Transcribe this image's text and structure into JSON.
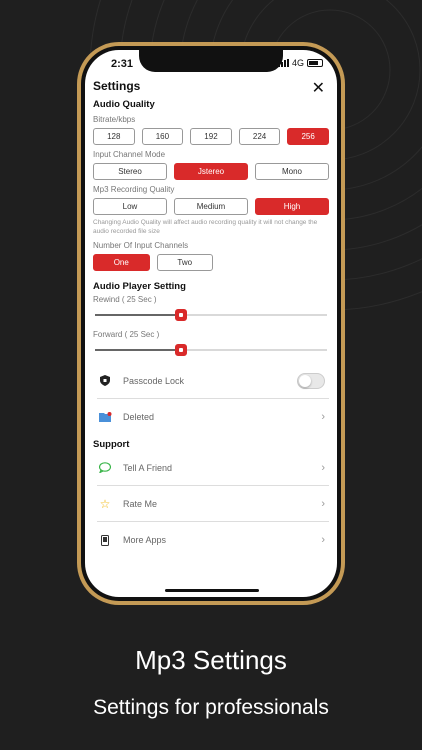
{
  "status": {
    "time": "2:31",
    "network": "4G"
  },
  "header": {
    "title": "Settings",
    "close_icon": "close-icon"
  },
  "audio_quality": {
    "title": "Audio Quality",
    "bitrate_label": "Bitrate/kbps",
    "bitrates": [
      "128",
      "160",
      "192",
      "224",
      "256"
    ],
    "selected_bitrate": "256",
    "channel_mode_label": "Input Channel Mode",
    "channel_modes": [
      "Stereo",
      "Jstereo",
      "Mono"
    ],
    "selected_channel_mode": "Jstereo",
    "recording_quality_label": "Mp3 Recording Quality",
    "recording_qualities": [
      "Low",
      "Medium",
      "High"
    ],
    "selected_recording_quality": "High",
    "note": "Changing Audio Quality will affect audio recording quality it will not change the audio recorded file size",
    "input_channels_label": "Number Of Input Channels",
    "input_channels": [
      "One",
      "Two"
    ],
    "selected_input_channels": "One"
  },
  "player": {
    "title": "Audio Player Setting",
    "rewind_label": "Rewind ( 25 Sec )",
    "rewind_fraction": 0.37,
    "forward_label": "Forward ( 25 Sec )",
    "forward_fraction": 0.37
  },
  "settings_rows": [
    {
      "label": "Passcode Lock",
      "icon": "shield-icon",
      "type": "toggle",
      "enabled": false
    },
    {
      "label": "Deleted",
      "icon": "folder-icon",
      "type": "link"
    }
  ],
  "support": {
    "title": "Support",
    "rows": [
      {
        "label": "Tell A Friend",
        "icon": "chat-bubble-icon"
      },
      {
        "label": "Rate Me",
        "icon": "star-icon"
      },
      {
        "label": "More Apps",
        "icon": "phone-icon"
      }
    ]
  },
  "caption": {
    "title": "Mp3 Settings",
    "subtitle": "Settings for professionals"
  },
  "colors": {
    "accent": "#d92a2a",
    "frame": "#c49a55",
    "background": "#1f1f1f"
  }
}
